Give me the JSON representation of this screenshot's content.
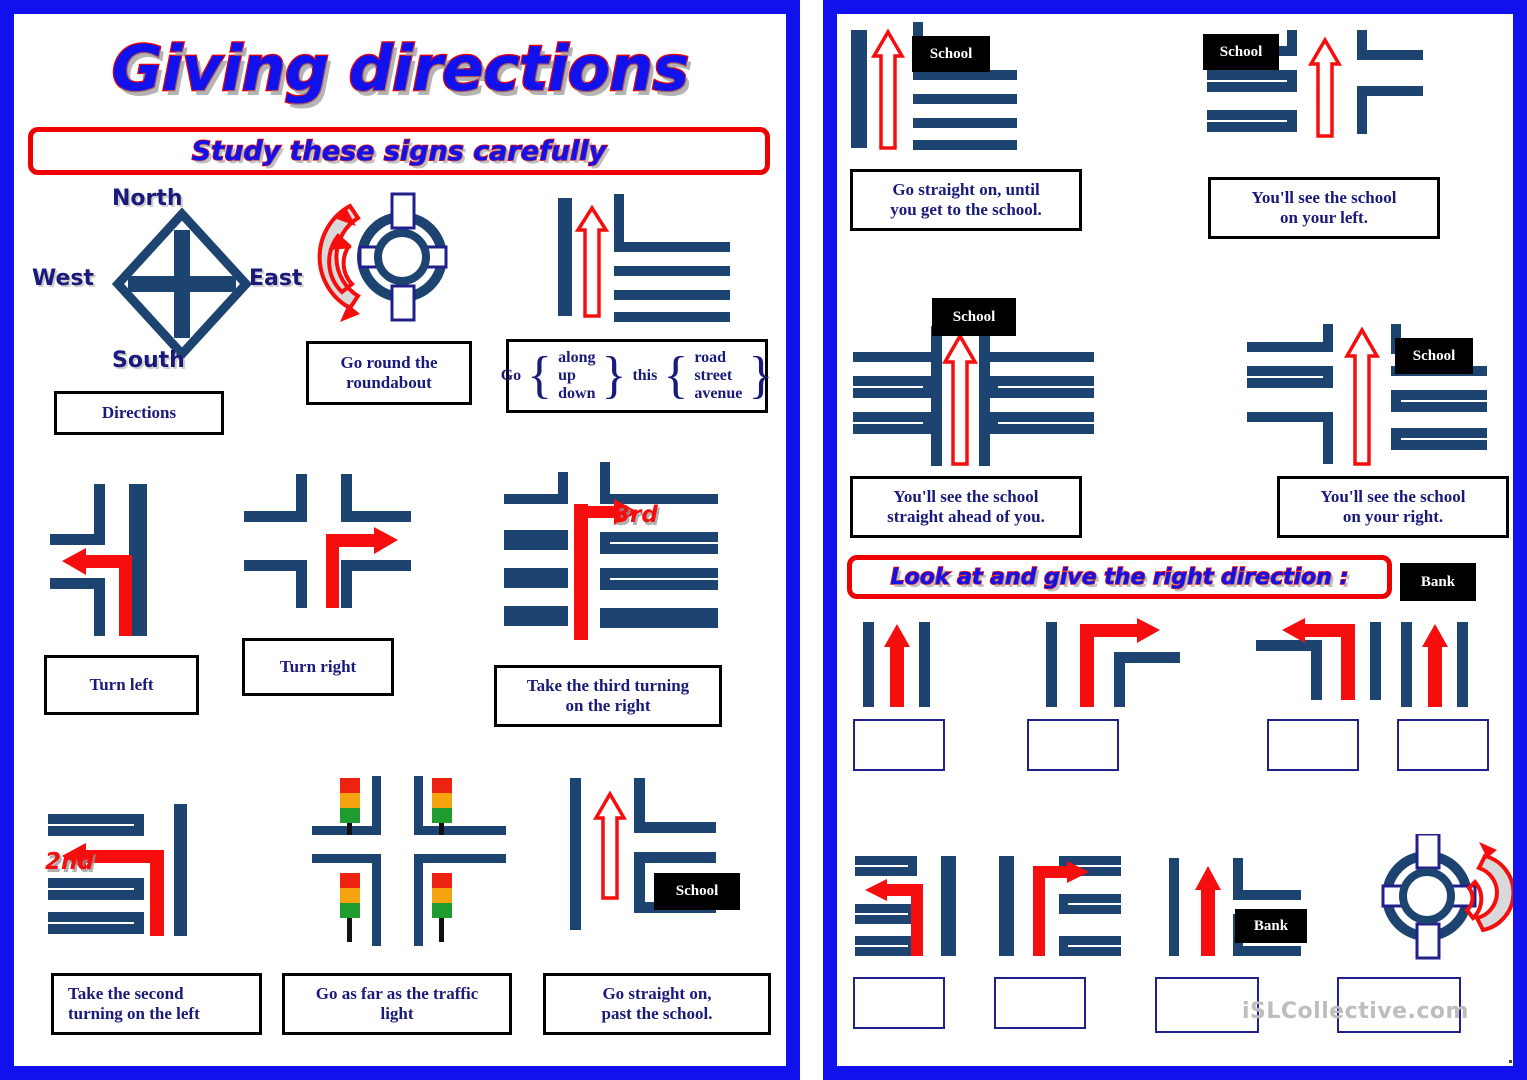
{
  "colors": {
    "page_border": "#1111ee",
    "road_navy": "#1d4370",
    "arrow_red": "#f60d0d",
    "title_blue": "#1111ee",
    "title_outline_red": "#ee0000",
    "caption_text": "#1a1a7a",
    "sign_black": "#000000",
    "answer_border": "#20208c",
    "traffic_red": "#ee2211",
    "traffic_amber": "#f5a30f",
    "traffic_green": "#1f9b2f"
  },
  "left_page": {
    "title": "Giving directions",
    "banner": "Study these signs carefully",
    "compass": {
      "north": "North",
      "south": "South",
      "east": "East",
      "west": "West",
      "caption": "Directions"
    },
    "items": [
      {
        "id": "roundabout",
        "caption": "Go round the\nroundabout"
      },
      {
        "id": "go-along-up-down",
        "caption": ""
      },
      {
        "id": "turn-left",
        "caption": "Turn left"
      },
      {
        "id": "turn-right",
        "caption": "Turn right"
      },
      {
        "id": "third-turning",
        "caption": "Take the third turning\non the right",
        "ordinal": "3rd"
      },
      {
        "id": "second-turning",
        "caption": "Take the second\nturning  on the left",
        "ordinal": "2nd"
      },
      {
        "id": "traffic-light",
        "caption": "Go as far as the traffic\nlight"
      },
      {
        "id": "past-school",
        "caption": "Go straight on,\npast the school.",
        "sign": "School"
      }
    ],
    "go_phrase": {
      "lead": "Go",
      "options_1": [
        "along",
        "up",
        "down"
      ],
      "middle": "this",
      "options_2": [
        "road",
        "street",
        "avenue"
      ]
    }
  },
  "right_page": {
    "banner": "Look at and give the right direction :",
    "examples": [
      {
        "id": "straight-until-school",
        "caption": "Go straight on, until\nyou get to the school.",
        "sign": "School"
      },
      {
        "id": "school-on-left",
        "caption": "You'll see the school\non your left.",
        "sign": "School"
      },
      {
        "id": "school-straight-ahead",
        "caption": "You'll see the school\nstraight ahead of you.",
        "sign": "School"
      },
      {
        "id": "school-on-right",
        "caption": "You'll see the school\non your right.",
        "sign": "School"
      }
    ],
    "exercises_row1": [
      {
        "id": "ex1",
        "answer": "",
        "sign": ""
      },
      {
        "id": "ex2",
        "answer": "",
        "sign": ""
      },
      {
        "id": "ex3",
        "answer": "",
        "sign": ""
      },
      {
        "id": "ex4",
        "answer": "",
        "sign": "Bank"
      }
    ],
    "exercises_row2": [
      {
        "id": "ex5",
        "answer": "",
        "sign": ""
      },
      {
        "id": "ex6",
        "answer": "",
        "sign": ""
      },
      {
        "id": "ex7",
        "answer": "",
        "sign": "Bank"
      },
      {
        "id": "ex8",
        "answer": "",
        "sign": ""
      }
    ],
    "watermark": "iSLCollective.com"
  }
}
